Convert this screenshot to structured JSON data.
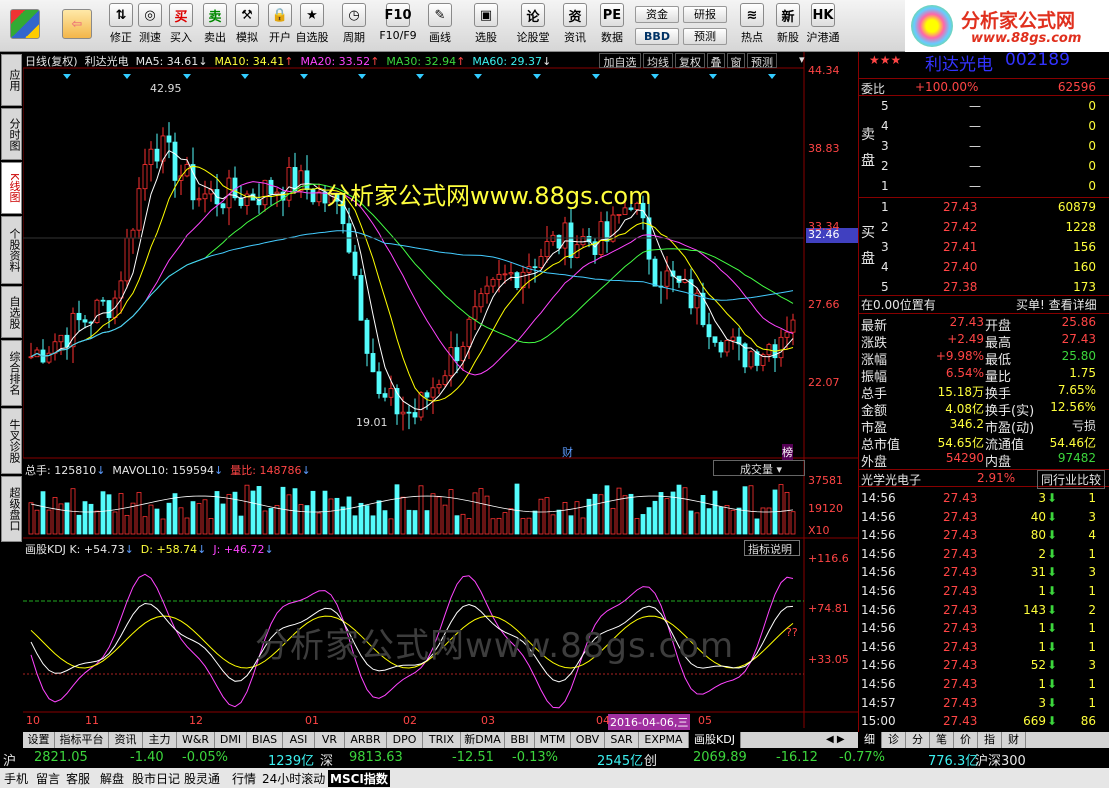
{
  "toolbar": {
    "buttons": [
      {
        "label": "修正",
        "icon": "up-down-arrows-icon"
      },
      {
        "label": "测速",
        "icon": "speed-icon"
      },
      {
        "label": "买入",
        "icon": "buy-icon"
      },
      {
        "label": "卖出",
        "icon": "sell-icon"
      },
      {
        "label": "模拟",
        "icon": "hammer-icon"
      },
      {
        "label": "开户",
        "icon": "lock-icon"
      },
      {
        "label": "自选股",
        "icon": "star-list-icon"
      },
      {
        "label": "周期",
        "icon": "clock-icon"
      },
      {
        "label": "F10/F9",
        "icon": "f10-icon"
      },
      {
        "label": "画线",
        "icon": "pencil-icon"
      },
      {
        "label": "选股",
        "icon": "monitor-icon"
      },
      {
        "label": "论股堂",
        "icon": "talk-icon"
      },
      {
        "label": "资讯",
        "icon": "info-icon"
      },
      {
        "label": "数据",
        "icon": "pe-icon"
      },
      {
        "label": "热点",
        "icon": "hot-icon"
      },
      {
        "label": "新股",
        "icon": "new-stock-icon"
      },
      {
        "label": "沪港通",
        "icon": "hk-icon"
      }
    ],
    "mini": [
      "资金",
      "研报",
      "BBD",
      "预测"
    ]
  },
  "logo": {
    "title": "分析家公式网",
    "url": "www.88gs.com"
  },
  "side_tabs": [
    "应用",
    "分时图",
    "K线图",
    "个股资料",
    "自选股",
    "综合排名",
    "牛叉诊股",
    "超级盘口"
  ],
  "kline": {
    "header": "日线(复权)",
    "name": "利达光电",
    "ma5": "MA5: 34.61",
    "ma10": "MA10: 34.41",
    "ma20": "MA20: 33.52",
    "ma30": "MA30: 32.94",
    "ma60": "MA60: 29.37",
    "btns": [
      "加自选",
      "均线",
      "复权",
      "叠",
      "窗",
      "预测"
    ],
    "yticks": [
      "44.34",
      "38.83",
      "33.34",
      "27.66",
      "22.07"
    ],
    "price_tag": "32.46",
    "high": "42.95",
    "low": "19.01",
    "watermark": "分析家公式网www.88gs.com",
    "marker_cai": "财",
    "marker_bang": "榜"
  },
  "volume": {
    "total": "总手: 125810",
    "mavol": "MAVOL10: 159594",
    "ratio": "量比: 148786",
    "select": "成交量",
    "yticks": [
      "37581",
      "19120",
      "X10"
    ]
  },
  "kdj": {
    "title": "画股KDJ",
    "k": "K: +54.73",
    "d": "D: +58.74",
    "j": "J: +46.72",
    "help": "指标说明",
    "yticks": [
      "+116.6",
      "+74.81",
      "+33.05"
    ],
    "watermark": "分析家公式网www.88gs.com",
    "qq": "??"
  },
  "xaxis": {
    "labels": [
      "10",
      "11",
      "12",
      "01",
      "02",
      "03",
      "04",
      "05"
    ],
    "cursor_date": "2016-04-06,三"
  },
  "bottom_tabs": [
    "设置",
    "指标平台",
    "资讯",
    "主力",
    "W&R",
    "DMI",
    "BIAS",
    "ASI",
    "VR",
    "ARBR",
    "DPO",
    "TRIX",
    "新DMA",
    "BBI",
    "MTM",
    "OBV",
    "SAR",
    "EXPMA",
    "画股KDJ"
  ],
  "right_tabs": [
    "细",
    "诊",
    "分",
    "笔",
    "价",
    "指",
    "财"
  ],
  "quote": {
    "stars": "★★★",
    "name": "利达光电",
    "code": "002189",
    "weibi_label": "委比",
    "weibi": "+100.00%",
    "weicha": "62596",
    "sell_label": "卖盘",
    "buy_label": "买盘",
    "sell": [
      {
        "n": "5",
        "p": "—",
        "v": "0"
      },
      {
        "n": "4",
        "p": "—",
        "v": "0"
      },
      {
        "n": "3",
        "p": "—",
        "v": "0"
      },
      {
        "n": "2",
        "p": "—",
        "v": "0"
      },
      {
        "n": "1",
        "p": "—",
        "v": "0"
      }
    ],
    "buy": [
      {
        "n": "1",
        "p": "27.43",
        "v": "60879"
      },
      {
        "n": "2",
        "p": "27.42",
        "v": "1228"
      },
      {
        "n": "3",
        "p": "27.41",
        "v": "156"
      },
      {
        "n": "4",
        "p": "27.40",
        "v": "160"
      },
      {
        "n": "5",
        "p": "27.38",
        "v": "173"
      }
    ],
    "position_note": "在0.00位置有",
    "position_link": "买单! 查看详细",
    "stats": [
      {
        "l1": "最新",
        "v1": "27.43",
        "l2": "开盘",
        "v2": "25.86"
      },
      {
        "l1": "涨跌",
        "v1": "+2.49",
        "l2": "最高",
        "v2": "27.43"
      },
      {
        "l1": "涨幅",
        "v1": "+9.98%",
        "l2": "最低",
        "v2": "25.80"
      },
      {
        "l1": "振幅",
        "v1": "6.54%",
        "l2": "量比",
        "v2": "1.75"
      },
      {
        "l1": "总手",
        "v1": "15.18万",
        "l2": "换手",
        "v2": "7.65%"
      },
      {
        "l1": "金额",
        "v1": "4.08亿",
        "l2": "换手(实)",
        "v2": "12.56%"
      },
      {
        "l1": "市盈",
        "v1": "346.2",
        "l2": "市盈(动)",
        "v2": "亏损"
      },
      {
        "l1": "总市值",
        "v1": "54.65亿",
        "l2": "流通值",
        "v2": "54.46亿"
      },
      {
        "l1": "外盘",
        "v1": "54290",
        "l2": "内盘",
        "v2": "97482"
      }
    ],
    "sector_name": "光学光电子",
    "sector_pct": "2.91%",
    "sector_compare": "同行业比较"
  },
  "ticks": [
    {
      "t": "14:56",
      "p": "27.43",
      "v": "3",
      "n": "1"
    },
    {
      "t": "14:56",
      "p": "27.43",
      "v": "40",
      "n": "3"
    },
    {
      "t": "14:56",
      "p": "27.43",
      "v": "80",
      "n": "4"
    },
    {
      "t": "14:56",
      "p": "27.43",
      "v": "2",
      "n": "1"
    },
    {
      "t": "14:56",
      "p": "27.43",
      "v": "31",
      "n": "3"
    },
    {
      "t": "14:56",
      "p": "27.43",
      "v": "1",
      "n": "1"
    },
    {
      "t": "14:56",
      "p": "27.43",
      "v": "143",
      "n": "2"
    },
    {
      "t": "14:56",
      "p": "27.43",
      "v": "1",
      "n": "1"
    },
    {
      "t": "14:56",
      "p": "27.43",
      "v": "1",
      "n": "1"
    },
    {
      "t": "14:56",
      "p": "27.43",
      "v": "52",
      "n": "3"
    },
    {
      "t": "14:56",
      "p": "27.43",
      "v": "1",
      "n": "1"
    },
    {
      "t": "14:57",
      "p": "27.43",
      "v": "3",
      "n": "1"
    },
    {
      "t": "15:00",
      "p": "27.43",
      "v": "669",
      "n": "86"
    }
  ],
  "index_bar": {
    "sh_label": "沪",
    "sh": "2821.05",
    "sh_chg": "-1.40",
    "sh_pct": "-0.05%",
    "sh_amt": "1239亿",
    "sz_label": "深",
    "sz": "9813.63",
    "sz_chg": "-12.51",
    "sz_pct": "-0.13%",
    "sz_amt": "2545亿",
    "cy_label": "创",
    "cy": "2069.89",
    "cy_chg": "-16.12",
    "cy_pct": "-0.77%",
    "hs_amt": "776.3亿",
    "hs_label": "沪深300"
  },
  "status_bar": [
    "手机",
    "留言",
    "客服",
    "解盘",
    "股市日记",
    "股灵通",
    "行情",
    "24小时滚动",
    "MSCI指数"
  ]
}
